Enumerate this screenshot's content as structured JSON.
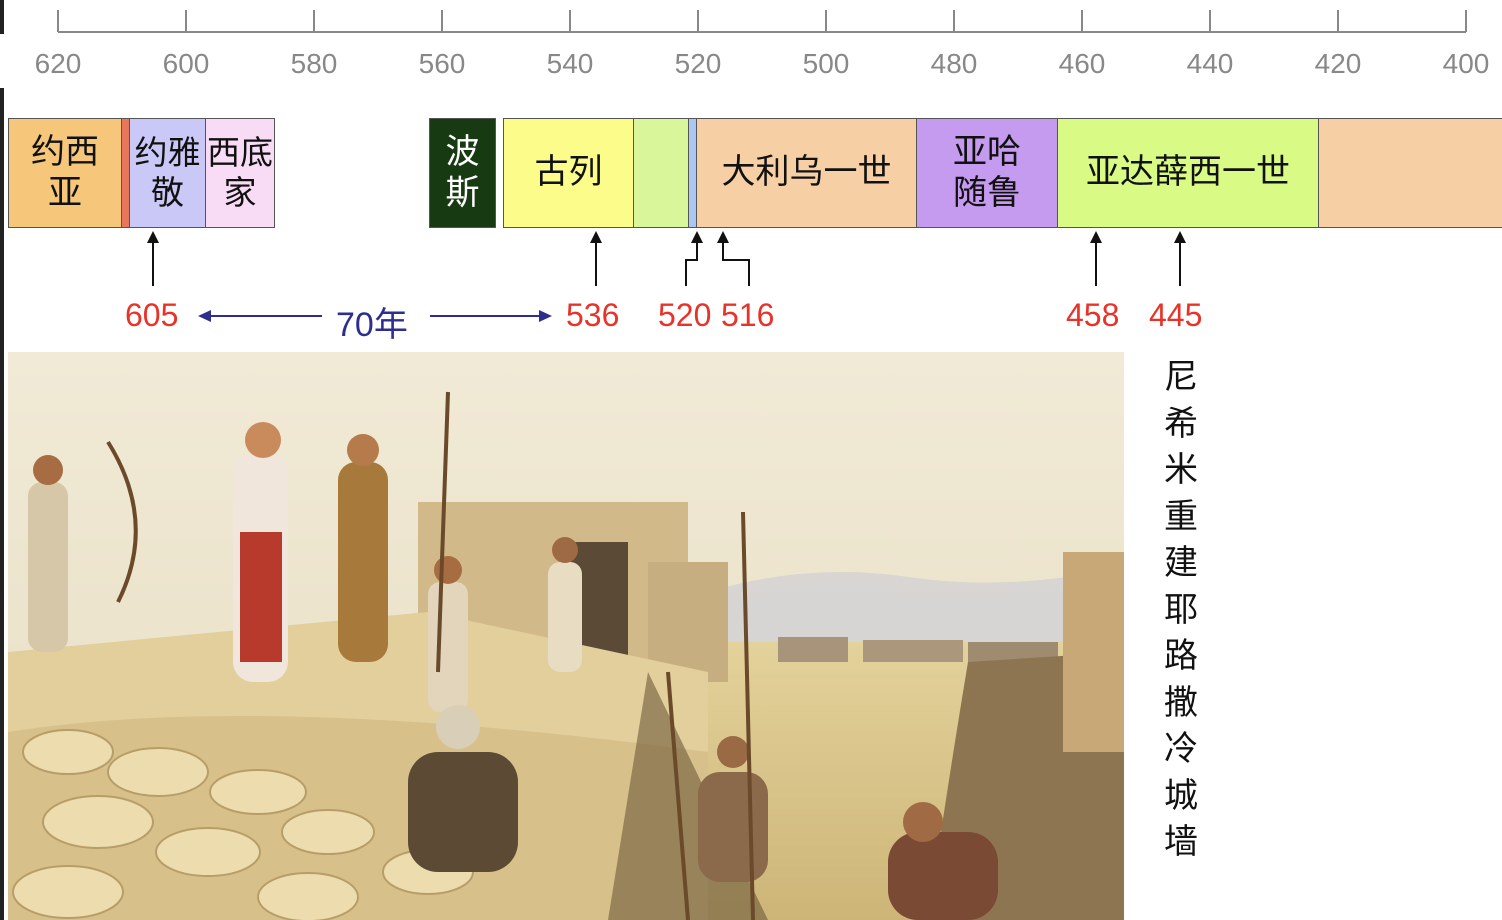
{
  "axis": {
    "ticks": [
      620,
      600,
      580,
      560,
      540,
      520,
      500,
      480,
      460,
      440,
      420,
      400
    ],
    "direction": "descending",
    "color": "#888888"
  },
  "periods": [
    {
      "id": "josiah",
      "label": "约西\n亚",
      "color": "#f6c77a"
    },
    {
      "id": "josiah-sliver",
      "label": "",
      "color": "#e8765a"
    },
    {
      "id": "jehoiakim",
      "label": "约雅\n敬",
      "color": "#c9c8f6"
    },
    {
      "id": "zedekiah",
      "label": "西底\n家",
      "color": "#f8dcf6"
    },
    {
      "id": "persia",
      "label": "波\n斯",
      "color": "#173a12"
    },
    {
      "id": "cyrus",
      "label": "古列",
      "color": "#fbfc8a"
    },
    {
      "id": "cambyses",
      "label": "",
      "color": "#d9f79a"
    },
    {
      "id": "smerdis",
      "label": "",
      "color": "#a9c7f2"
    },
    {
      "id": "darius",
      "label": "大利乌一世",
      "color": "#f7cfa4"
    },
    {
      "id": "xerxes",
      "label": "亚哈\n随鲁",
      "color": "#c59bf0"
    },
    {
      "id": "artaxerxes",
      "label": "亚达薛西一世",
      "color": "#d9fb86"
    },
    {
      "id": "later",
      "label": "",
      "color": "#f7cfa4"
    }
  ],
  "markers": [
    {
      "year": 605,
      "label": "605"
    },
    {
      "year": 536,
      "label": "536"
    },
    {
      "year": 520,
      "label": "520"
    },
    {
      "year": 516,
      "label": "516"
    },
    {
      "year": 458,
      "label": "458"
    },
    {
      "year": 445,
      "label": "445"
    }
  ],
  "span": {
    "label": "70年",
    "from": 605,
    "to": 536,
    "color": "#2e2e8f"
  },
  "marker_color": "#e8332a",
  "caption": "尼希米重建耶路撒冷城墙",
  "illustration": "rebuilding-wall-painting"
}
